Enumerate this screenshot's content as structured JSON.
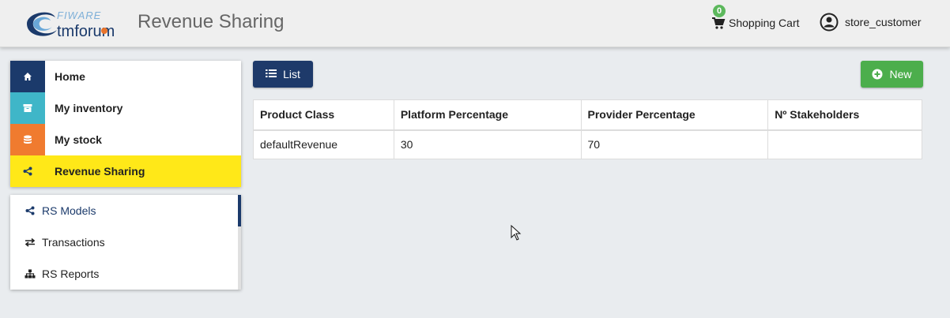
{
  "header": {
    "logo_top": "FIWARE",
    "logo_bottom": "tmforum",
    "title": "Revenue Sharing",
    "cart": {
      "count": "0",
      "label": "Shopping Cart",
      "icon": "cart-icon"
    },
    "user": {
      "label": "store_customer",
      "icon": "user-circle-icon"
    }
  },
  "menu": {
    "items": [
      {
        "label": "Home",
        "icon": "home-icon",
        "color": "#1b3a6b"
      },
      {
        "label": "My inventory",
        "icon": "archive-icon",
        "color": "#3fb6c8"
      },
      {
        "label": "My stock",
        "icon": "database-icon",
        "color": "#f07b2f"
      },
      {
        "label": "Revenue Sharing",
        "icon": "share-icon",
        "color": "#ffe818"
      }
    ]
  },
  "submenu": {
    "items": [
      {
        "label": "RS Models",
        "icon": "share-icon"
      },
      {
        "label": "Transactions",
        "icon": "exchange-icon"
      },
      {
        "label": "RS Reports",
        "icon": "sitemap-icon"
      }
    ]
  },
  "toolbar": {
    "list_label": "List",
    "new_label": "New"
  },
  "table": {
    "headers": [
      "Product Class",
      "Platform Percentage",
      "Provider Percentage",
      "Nº Stakeholders"
    ],
    "rows": [
      [
        "defaultRevenue",
        "30",
        "70",
        ""
      ]
    ]
  },
  "colors": {
    "primary": "#1e3a6a",
    "success": "#4cae4c",
    "active": "#ffe818"
  }
}
